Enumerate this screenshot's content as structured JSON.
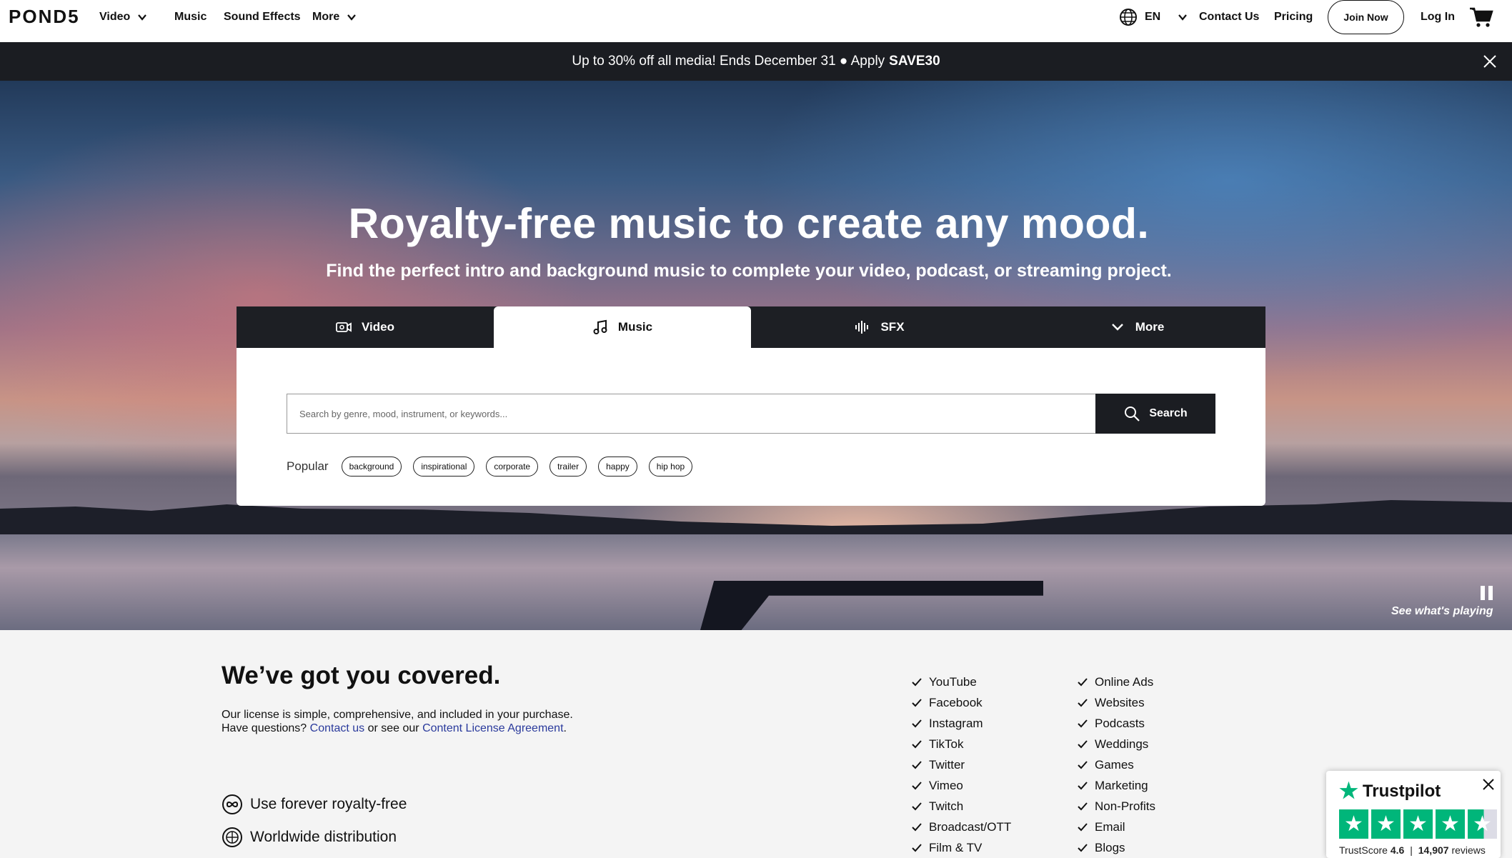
{
  "brand": {
    "logo": "POND5"
  },
  "nav": {
    "video": "Video",
    "music": "Music",
    "sound_effects": "Sound Effects",
    "more": "More",
    "language": "EN",
    "contact": "Contact Us",
    "pricing": "Pricing",
    "join": "Join Now",
    "login": "Log In"
  },
  "promo": {
    "text": "Up to 30% off all media! Ends December 31 ● Apply",
    "code": "SAVE30"
  },
  "hero": {
    "title": "Royalty-free music to create any mood.",
    "subtitle": "Find the perfect intro and background music to complete your video, podcast, or streaming project."
  },
  "tabs": [
    {
      "label": "Video",
      "icon": "camera-icon"
    },
    {
      "label": "Music",
      "icon": "music-note-icon",
      "active": true
    },
    {
      "label": "SFX",
      "icon": "waveform-icon"
    },
    {
      "label": "More",
      "icon": "chevron-down-icon"
    }
  ],
  "search": {
    "placeholder": "Search by genre, mood, instrument, or keywords...",
    "button": "Search",
    "popular_label": "Popular",
    "popular_tags": [
      "background",
      "inspirational",
      "corporate",
      "trailer",
      "happy",
      "hip hop"
    ]
  },
  "player": {
    "see_playing": "See what's playing"
  },
  "covered": {
    "title": "We’ve got you covered.",
    "desc_prefix": "Our license is simple, comprehensive, and included in your purchase. Have questions? ",
    "contact_link": "Contact us",
    "desc_middle": " or see our ",
    "license_link": "Content License Agreement",
    "desc_suffix": ".",
    "features": [
      "Use forever royalty-free",
      "Worldwide distribution"
    ],
    "uses_col1": [
      "YouTube",
      "Facebook",
      "Instagram",
      "TikTok",
      "Twitter",
      "Vimeo",
      "Twitch",
      "Broadcast/OTT",
      "Film & TV"
    ],
    "uses_col2": [
      "Online Ads",
      "Websites",
      "Podcasts",
      "Weddings",
      "Games",
      "Marketing",
      "Non-Profits",
      "Email",
      "Blogs"
    ]
  },
  "trustpilot": {
    "brand": "Trustpilot",
    "score_label": "TrustScore",
    "score": "4.6",
    "reviews_count": "14,907",
    "reviews_label": "reviews",
    "rating": 4.6,
    "color": "#00b67a"
  },
  "colors": {
    "dark": "#1b1d22",
    "link": "#2a3a9c",
    "section_bg": "#f4f4f4"
  }
}
